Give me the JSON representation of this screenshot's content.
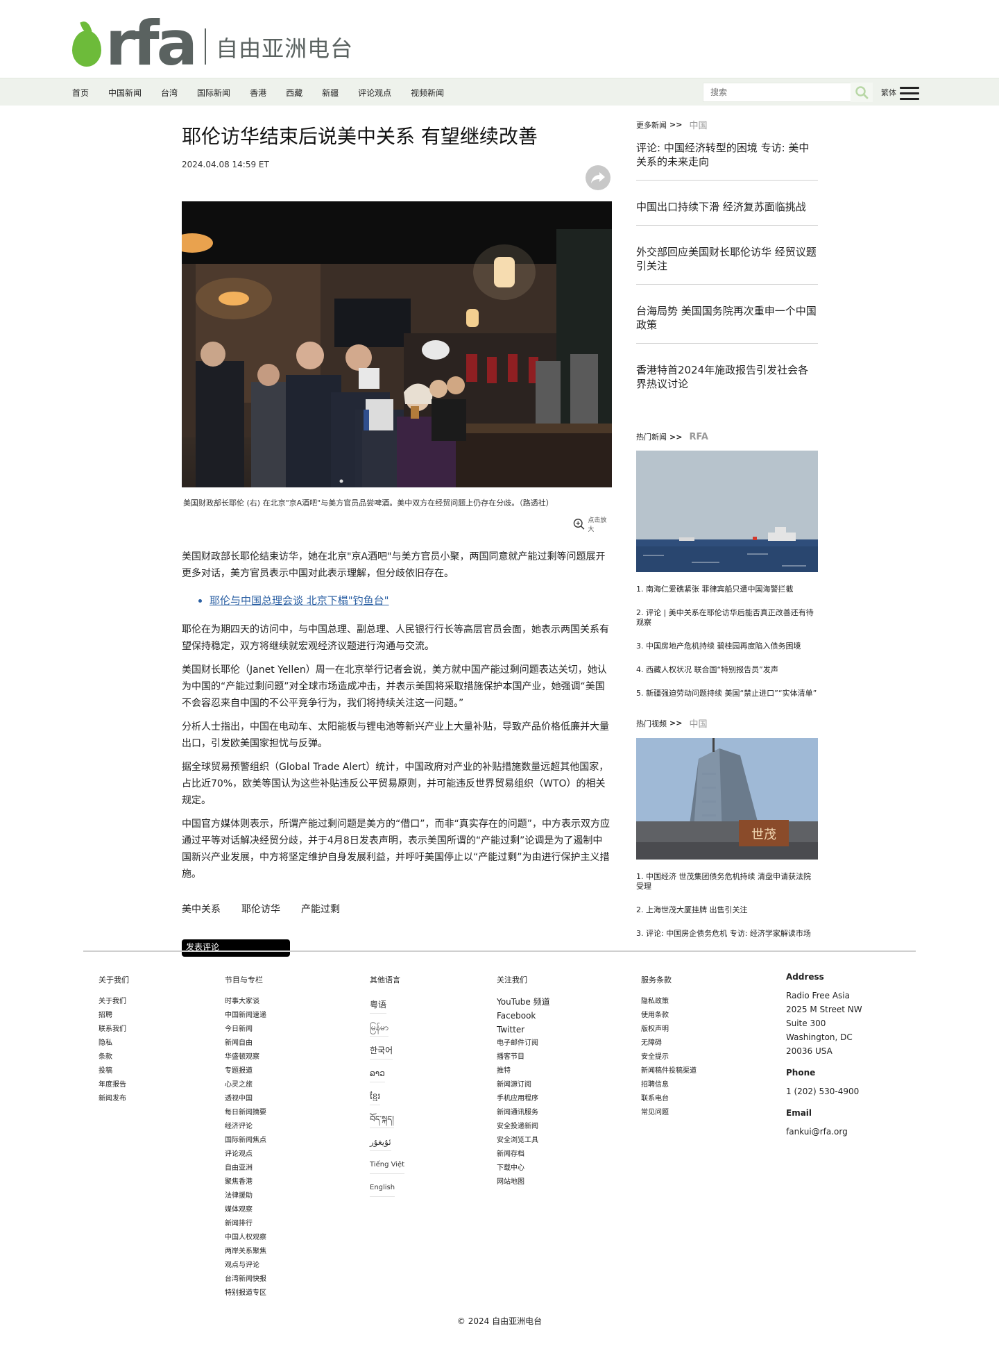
{
  "header": {
    "logo_text": "rfa",
    "logo_cn": "自由亚洲电台",
    "nav": [
      "首页",
      "中国新闻",
      "台湾",
      "国际新闻",
      "香港",
      "西藏",
      "新疆",
      "评论观点",
      "视频新闻"
    ],
    "search_placeholder": "搜索",
    "lang_switch": "繁体"
  },
  "article": {
    "title": "耶伦访华结束后说美中关系    有望继续改善",
    "date": "2024.04.08 14:59 ET",
    "caption": "美国财政部长耶伦 (右) 在北京\"京A酒吧\"与美方官员品尝啤酒。美中双方在经贸问题上仍存在分歧。（路透社）",
    "zoom_label": "点击放大",
    "para1": "美国财政部长耶伦结束访华，她在北京\"京A酒吧\"与美方官员小聚，两国同意就产能过剩等问题展开更多对话，美方官员表示中国对此表示理解，但分歧依旧存在。",
    "related_link": "耶伦与中国总理会谈 北京下榻\"钓鱼台\"",
    "para2": "耶伦在为期四天的访问中，与中国总理、副总理、人民银行行长等高层官员会面，她表示两国关系有望保持稳定，双方将继续就宏观经济议题进行沟通与交流。",
    "para3": "美国财长耶伦（Janet Yellen）周一在北京举行记者会说，美方就中国产能过剩问题表达关切，她认为中国的“产能过剩问题”对全球市场造成冲击，并表示美国将采取措施保护本国产业，她强调“美国不会容忍来自中国的不公平竞争行为，我们将持续关注这一问题。”",
    "para4": "分析人士指出，中国在电动车、太阳能板与锂电池等新兴产业上大量补贴，导致产品价格低廉并大量出口，引发欧美国家担忧与反弹。",
    "para5": "据全球贸易预警组织（Global Trade Alert）统计，中国政府对产业的补贴措施数量远超其他国家，占比近70%，欧美等国认为这些补贴违反公平贸易原则，并可能违反世界贸易组织（WTO）的相关规定。",
    "para6": "中国官方媒体则表示，所谓产能过剩问题是美方的“借口”，而非“真实存在的问题”，中方表示双方应通过平等对话解决经贸分歧，并于4月8日发表声明，表示美国所谓的“产能过剩”论调是为了遏制中国新兴产业发展，中方将坚定维护自身发展利益，并呼吁美国停止以“产能过剩”为由进行保护主义措施。",
    "tags": [
      "美中关系",
      "耶伦访华",
      "产能过剩"
    ],
    "black_button": "发表评论"
  },
  "sidebar": {
    "section1_label": "更多新闻",
    "section1_sub": "中国",
    "links": [
      "评论: 中国经济转型的困境 专访: 美中关系的未来走向",
      "中国出口持续下滑 经济复苏面临挑战",
      "外交部回应美国财长耶伦访华 经贸议题引关注",
      "台海局势    美国国务院再次重申一个中国政策",
      "香港特首2024年施政报告引发社会各界热议讨论"
    ],
    "section2_label": "热门新闻",
    "section2_sub": "RFA",
    "popular": [
      "1. 南海仁爱礁紧张 菲律宾船只遭中国海警拦截",
      "2. 评论 | 美中关系在耶伦访华后能否真正改善还有待观察",
      "3. 中国房地产危机持续    碧桂园再度陷入债务困境",
      "4. 西藏人权状况    联合国“特别报告员”发声",
      "5. 新疆强迫劳动问题持续    美国“禁止进口”“实体清单”"
    ],
    "section3_label": "热门视频",
    "section3_sub": "中国",
    "videos": [
      "1. 中国经济    世茂集团债务危机持续 清盘申请获法院受理",
      "2. 上海世茂大厦挂牌    出售引关注",
      "3. 评论: 中国房企债务危机 专访: 经济学家解读市场"
    ]
  },
  "footer": {
    "col1_title": "关于我们",
    "col1": [
      "关于我们",
      "招聘",
      "联系我们",
      "隐私",
      "条款",
      "投稿",
      "年度报告",
      "新闻发布"
    ],
    "col2_title": "节目与专栏",
    "col2": [
      "时事大家谈",
      "中国新闻速递",
      "今日新闻",
      "新闻自由",
      "华盛顿观察",
      "专题报道",
      "心灵之旅",
      "透视中国",
      "每日新闻摘要",
      "经济评论",
      "国际新闻焦点",
      "评论观点",
      "自由亚洲",
      "聚焦香港",
      "法律援助",
      "媒体观察",
      "新闻排行",
      "中国人权观察",
      "两岸关系聚焦",
      "观点与评论",
      "台湾新闻快报",
      "特别报道专区"
    ],
    "col3_title": "其他语言",
    "col3": [
      "粤语",
      "မြန်မာ",
      "한국어",
      "ລາວ",
      "ខ្មែរ",
      "བོད་སྐད།",
      "ئۇيغۇر",
      "Tiếng Việt",
      "English"
    ],
    "col4_title": "关注我们",
    "col4": [
      "YouTube 频道",
      "Facebook",
      "Twitter",
      "电子邮件订阅",
      "播客节目",
      "推特",
      "新闻源订阅",
      "手机应用程序",
      "新闻通讯服务",
      "安全投递新闻",
      "安全浏览工具",
      "新闻存档",
      "下载中心",
      "网站地图"
    ],
    "col5_title": "服务条款",
    "col5": [
      "隐私政策",
      "使用条款",
      "版权声明",
      "无障碍",
      "安全提示",
      "新闻稿件投稿渠道",
      "招聘信息",
      "联系电台",
      "常见问题"
    ],
    "address_title": "Address",
    "address_lines": [
      "Radio Free Asia",
      "2025 M Street NW",
      "Suite 300",
      "Washington, DC",
      "20036 USA"
    ],
    "phone_title": "Phone",
    "phone": "1 (202) 530-4900",
    "email_title": "Email",
    "email": "fankui@rfa.org",
    "copyright": "© 2024 自由亚洲电台"
  }
}
